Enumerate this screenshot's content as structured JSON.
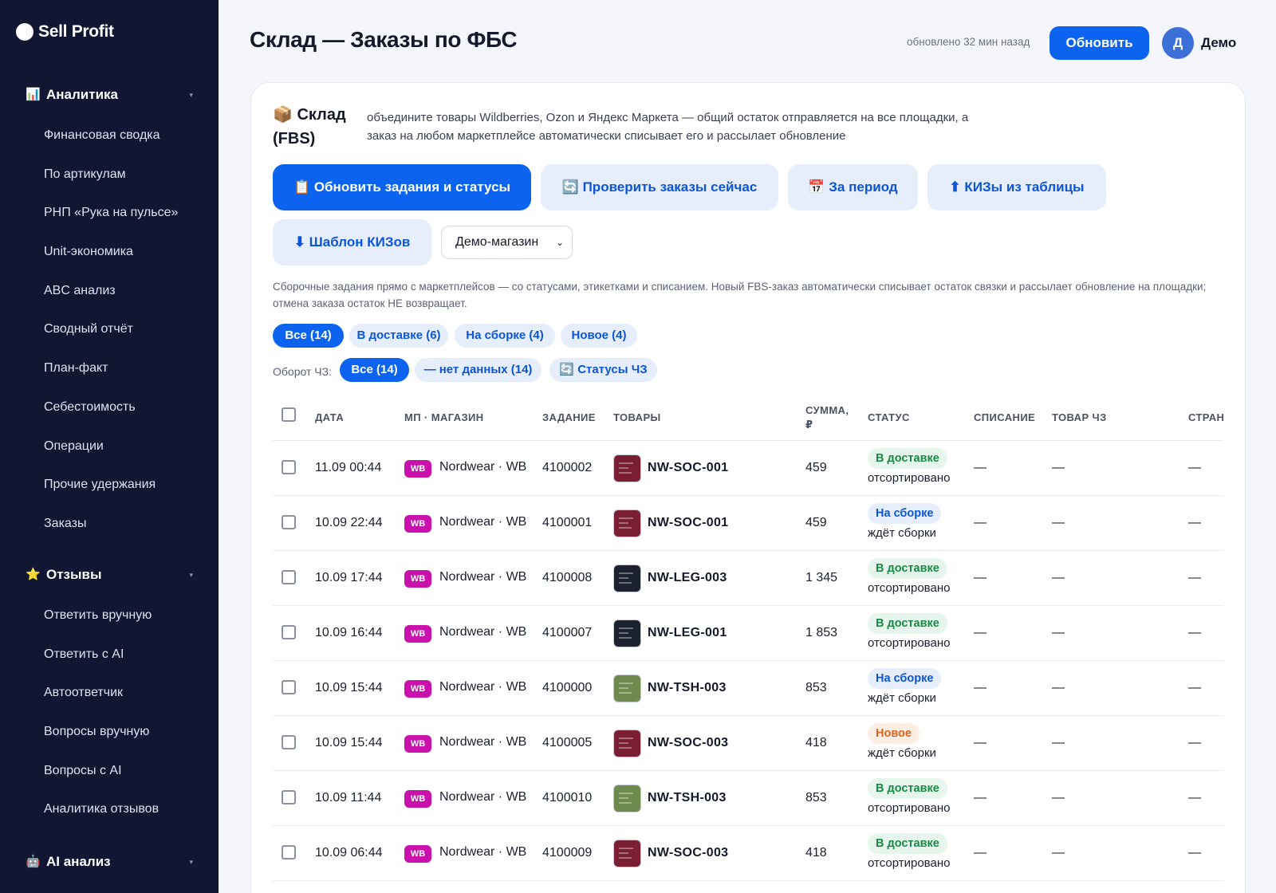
{
  "sidebar": {
    "logo": "Sell Profit",
    "groups": [
      {
        "title": "Аналитика",
        "icon": "bar-chart-icon",
        "items": [
          "Финансовая сводка",
          "По артикулам",
          "РНП «Рука на пульсе»",
          "Unit-экономика",
          "ABC анализ",
          "Сводный отчёт",
          "План-факт",
          "Себестоимость",
          "Операции",
          "Прочие удержания",
          "Заказы"
        ]
      },
      {
        "title": "Отзывы",
        "icon": "star-icon",
        "items": [
          "Ответить вручную",
          "Ответить с AI",
          "Автоответчик",
          "Вопросы вручную",
          "Вопросы с AI",
          "Аналитика отзывов"
        ]
      },
      {
        "title": "AI анализ",
        "icon": "robot-icon",
        "items": []
      }
    ]
  },
  "header": {
    "title": "Склад — Заказы по ФБС",
    "updated": "обновлено 32 мин назад",
    "refresh_label": "Обновить",
    "avatar_letter": "Д",
    "username": "Демо"
  },
  "card": {
    "title": "📦 Склад (FBS)",
    "description": "объедините товары Wildberries, Ozon и Яндекс Маркета — общий остаток отправляется на все площадки, а заказ на любом маркетплейсе автоматически списывает его и рассылает обновление",
    "actions": [
      {
        "label": "📋 Обновить задания и статусы"
      },
      {
        "label": "🔄 Проверить заказы сейчас"
      },
      {
        "label": "📅 За период"
      },
      {
        "label": "⬆ КИЗы из таблицы"
      },
      {
        "label": "⬇ Шаблон КИЗов"
      }
    ],
    "store_select": "Демо-магазин",
    "info": "Сборочные задания прямо с маркетплейсов — со статусами, этикетками и списанием. Новый FBS-заказ автоматически списывает остаток связки и рассылает обновление на площадки; отмена заказа остаток НЕ возвращает.",
    "filters": [
      "Все (14)",
      "В доставке (6)",
      "На сборке (4)",
      "Новое (4)"
    ],
    "chz_label": "Оборот ЧЗ:",
    "chz_filters": [
      "Все (14)",
      "— нет данных (14)",
      "🔄 Статусы ЧЗ"
    ]
  },
  "table": {
    "columns": [
      "ДАТА",
      "МП · МАГАЗИН",
      "ЗАДАНИЕ",
      "ТОВАРЫ",
      "СУММА, ₽",
      "СТАТУС",
      "СПИСАНИЕ",
      "ТОВАР ЧЗ",
      "СТРАН"
    ],
    "rows": [
      {
        "date": "11.09 00:44",
        "mp": "WB",
        "store": "Nordwear · WB",
        "task": "4100002",
        "sku": "NW-SOC-001",
        "thumb": "#7a1f33",
        "sum": "459",
        "status": "В доставке",
        "status_kind": "delivery",
        "sub": "отсортировано",
        "writeoff": "—",
        "chz": "—",
        "country": "—"
      },
      {
        "date": "10.09 22:44",
        "mp": "WB",
        "store": "Nordwear · WB",
        "task": "4100001",
        "sku": "NW-SOC-001",
        "thumb": "#7a1f33",
        "sum": "459",
        "status": "На сборке",
        "status_kind": "assembly",
        "sub": "ждёт сборки",
        "writeoff": "—",
        "chz": "—",
        "country": "—"
      },
      {
        "date": "10.09 17:44",
        "mp": "WB",
        "store": "Nordwear · WB",
        "task": "4100008",
        "sku": "NW-LEG-003",
        "thumb": "#1d2230",
        "sum": "1 345",
        "status": "В доставке",
        "status_kind": "delivery",
        "sub": "отсортировано",
        "writeoff": "—",
        "chz": "—",
        "country": "—"
      },
      {
        "date": "10.09 16:44",
        "mp": "WB",
        "store": "Nordwear · WB",
        "task": "4100007",
        "sku": "NW-LEG-001",
        "thumb": "#1d2230",
        "sum": "1 853",
        "status": "В доставке",
        "status_kind": "delivery",
        "sub": "отсортировано",
        "writeoff": "—",
        "chz": "—",
        "country": "—"
      },
      {
        "date": "10.09 15:44",
        "mp": "WB",
        "store": "Nordwear · WB",
        "task": "4100000",
        "sku": "NW-TSH-003",
        "thumb": "#6f8a4e",
        "sum": "853",
        "status": "На сборке",
        "status_kind": "assembly",
        "sub": "ждёт сборки",
        "writeoff": "—",
        "chz": "—",
        "country": "—"
      },
      {
        "date": "10.09 15:44",
        "mp": "WB",
        "store": "Nordwear · WB",
        "task": "4100005",
        "sku": "NW-SOC-003",
        "thumb": "#7a1f33",
        "sum": "418",
        "status": "Новое",
        "status_kind": "new",
        "sub": "ждёт сборки",
        "writeoff": "—",
        "chz": "—",
        "country": "—"
      },
      {
        "date": "10.09 11:44",
        "mp": "WB",
        "store": "Nordwear · WB",
        "task": "4100010",
        "sku": "NW-TSH-003",
        "thumb": "#6f8a4e",
        "sum": "853",
        "status": "В доставке",
        "status_kind": "delivery",
        "sub": "отсортировано",
        "writeoff": "—",
        "chz": "—",
        "country": "—"
      },
      {
        "date": "10.09 06:44",
        "mp": "WB",
        "store": "Nordwear · WB",
        "task": "4100009",
        "sku": "NW-SOC-003",
        "thumb": "#7a1f33",
        "sum": "418",
        "status": "В доставке",
        "status_kind": "delivery",
        "sub": "отсортировано",
        "writeoff": "—",
        "chz": "—",
        "country": "—"
      }
    ]
  },
  "colors": {
    "sidebar_bg": "#111733",
    "accent": "#0b63f0",
    "wb_brand": "#cb11ab"
  }
}
